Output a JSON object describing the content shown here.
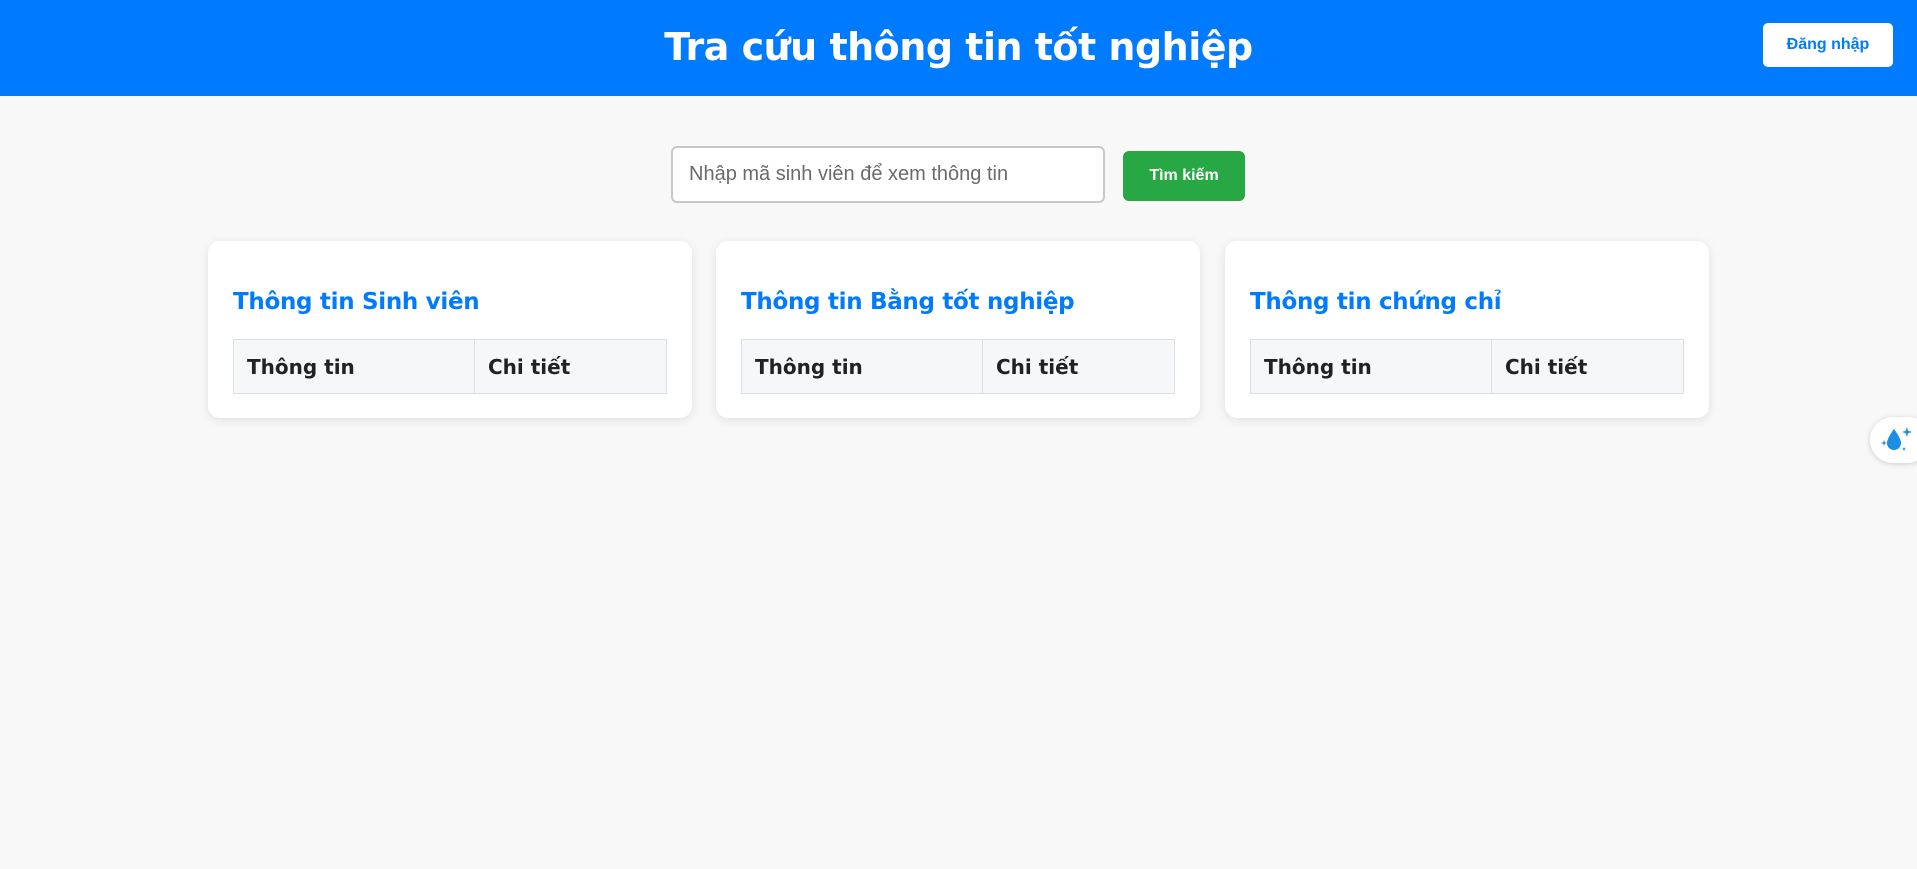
{
  "header": {
    "title": "Tra cứu thông tin tốt nghiệp",
    "login_label": "Đăng nhập"
  },
  "search": {
    "placeholder": "Nhập mã sinh viên để xem thông tin",
    "value": "",
    "button_label": "Tìm kiếm"
  },
  "cards": [
    {
      "title": "Thông tin Sinh viên",
      "col1": "Thông tin",
      "col2": "Chi tiết"
    },
    {
      "title": "Thông tin Bằng tốt nghiệp",
      "col1": "Thông tin",
      "col2": "Chi tiết"
    },
    {
      "title": "Thông tin chứng chỉ",
      "col1": "Thông tin",
      "col2": "Chi tiết"
    }
  ],
  "floating_widget": {
    "icon": "water-drop-sparkle-icon"
  },
  "colors": {
    "primary": "#007bff",
    "success": "#28a745",
    "background": "#f8f8f8"
  }
}
